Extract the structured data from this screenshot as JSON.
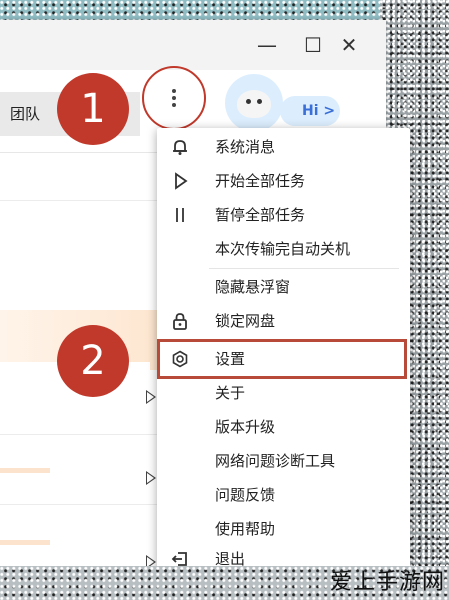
{
  "window": {
    "minimize_label": "—",
    "maximize_label": "☐",
    "close_label": "✕"
  },
  "toolbar": {
    "team_tab_label": "团队",
    "hi_label": "Hi >"
  },
  "annotations": {
    "step_1": "1",
    "step_2": "2"
  },
  "menu": {
    "items": [
      {
        "label": "系统消息",
        "icon": "bell-icon"
      },
      {
        "label": "开始全部任务",
        "icon": "play-icon"
      },
      {
        "label": "暂停全部任务",
        "icon": "pause-icon"
      },
      {
        "label": "本次传输完自动关机",
        "icon": ""
      },
      {
        "label": "隐藏悬浮窗",
        "icon": ""
      },
      {
        "label": "锁定网盘",
        "icon": "lock-icon"
      },
      {
        "label": "设置",
        "icon": "settings-icon"
      },
      {
        "label": "关于",
        "icon": ""
      },
      {
        "label": "版本升级",
        "icon": ""
      },
      {
        "label": "网络问题诊断工具",
        "icon": ""
      },
      {
        "label": "问题反馈",
        "icon": ""
      },
      {
        "label": "使用帮助",
        "icon": ""
      },
      {
        "label": "退出",
        "icon": "logout-icon"
      }
    ]
  },
  "watermark": "爱上手游网",
  "colors": {
    "annotation_red": "#c0392b",
    "highlight_border": "#b84a3a",
    "accent_blue": "#3a6fd8"
  }
}
